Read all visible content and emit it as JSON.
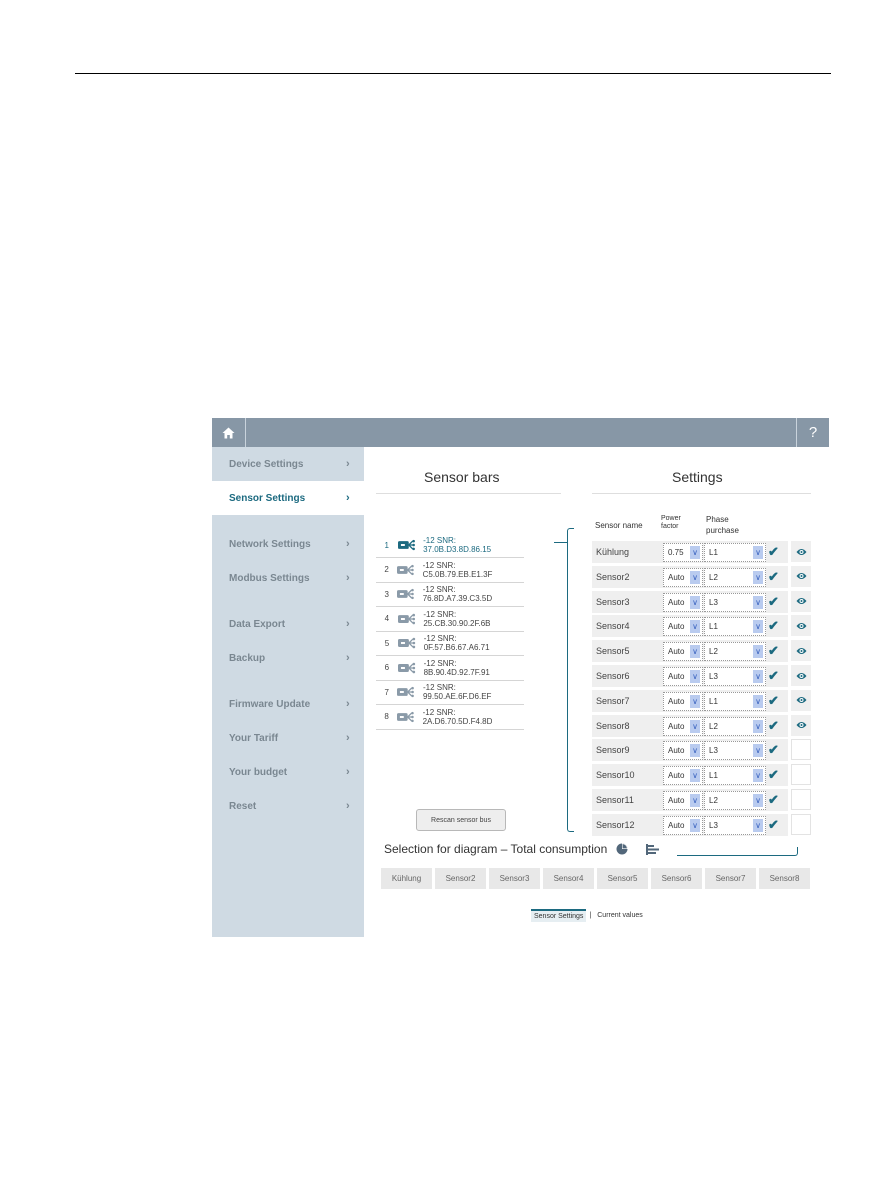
{
  "topbar": {
    "home_icon": "home-icon",
    "help_label": "?"
  },
  "sidebar": {
    "items": [
      {
        "label": "Device Settings",
        "active": false
      },
      {
        "label": "Sensor Settings",
        "active": true
      },
      {
        "label": "Network Settings",
        "active": false
      },
      {
        "label": "Modbus Settings",
        "active": false
      },
      {
        "label": "Data Export",
        "active": false
      },
      {
        "label": "Backup",
        "active": false
      },
      {
        "label": "Firmware Update",
        "active": false
      },
      {
        "label": "Your Tariff",
        "active": false
      },
      {
        "label": "Your budget",
        "active": false
      },
      {
        "label": "Reset",
        "active": false
      }
    ],
    "chevron": "›"
  },
  "sensor_bars": {
    "title": "Sensor bars",
    "rows": [
      {
        "num": "1",
        "snr": "-12 SNR: 37.0B.D3.8D.86.15"
      },
      {
        "num": "2",
        "snr": "-12 SNR: C5.0B.79.EB.E1.3F"
      },
      {
        "num": "3",
        "snr": "-12 SNR: 76.8D.A7.39.C3.5D"
      },
      {
        "num": "4",
        "snr": "-12 SNR: 25.CB.30.90.2F.6B"
      },
      {
        "num": "5",
        "snr": "-12 SNR: 0F.57.B6.67.A6.71"
      },
      {
        "num": "6",
        "snr": "-12 SNR: 8B.90.4D.92.7F.91"
      },
      {
        "num": "7",
        "snr": "-12 SNR: 99.50.AE.6F.D6.EF"
      },
      {
        "num": "8",
        "snr": "-12 SNR: 2A.D6.70.5D.F4.8D"
      }
    ],
    "rescan_label": "Rescan sensor bus"
  },
  "settings": {
    "title": "Settings",
    "headers": {
      "name": "Sensor name",
      "power_factor_1": "Power",
      "power_factor_2": "factor",
      "phase_1": "Phase",
      "phase_2": "purchase"
    },
    "rows": [
      {
        "name": "Kühlung",
        "pf": "0.75",
        "phase": "L1",
        "visible": true
      },
      {
        "name": "Sensor2",
        "pf": "Auto",
        "phase": "L2",
        "visible": true
      },
      {
        "name": "Sensor3",
        "pf": "Auto",
        "phase": "L3",
        "visible": true
      },
      {
        "name": "Sensor4",
        "pf": "Auto",
        "phase": "L1",
        "visible": true
      },
      {
        "name": "Sensor5",
        "pf": "Auto",
        "phase": "L2",
        "visible": true
      },
      {
        "name": "Sensor6",
        "pf": "Auto",
        "phase": "L3",
        "visible": true
      },
      {
        "name": "Sensor7",
        "pf": "Auto",
        "phase": "L1",
        "visible": true
      },
      {
        "name": "Sensor8",
        "pf": "Auto",
        "phase": "L2",
        "visible": true
      },
      {
        "name": "Sensor9",
        "pf": "Auto",
        "phase": "L3",
        "visible": false
      },
      {
        "name": "Sensor10",
        "pf": "Auto",
        "phase": "L1",
        "visible": false
      },
      {
        "name": "Sensor11",
        "pf": "Auto",
        "phase": "L2",
        "visible": false
      },
      {
        "name": "Sensor12",
        "pf": "Auto",
        "phase": "L3",
        "visible": false
      }
    ]
  },
  "diagram": {
    "title": "Selection for diagram – Total consumption",
    "pie_icon": "pie-chart-icon",
    "bar_icon": "bar-chart-icon",
    "buttons": [
      "Kühlung",
      "Sensor2",
      "Sensor3",
      "Sensor4",
      "Sensor5",
      "Sensor6",
      "Sensor7",
      "Sensor8"
    ]
  },
  "tabs": {
    "items": [
      "Sensor Settings",
      "Current values"
    ],
    "active": 0,
    "separator": "|"
  },
  "colors": {
    "accent": "#1c6a80",
    "topbar": "#8797a6",
    "sidebar": "#cfdae3"
  }
}
